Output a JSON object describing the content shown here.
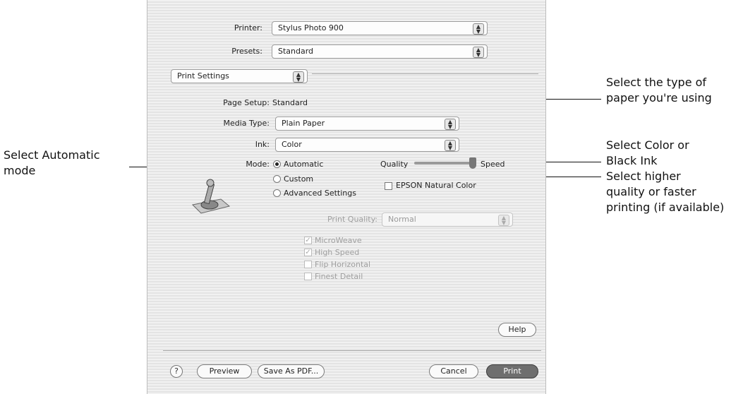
{
  "callouts": {
    "paper_type": "Select the type of\npaper you're using",
    "color_ink": "Select Color or\nBlack Ink",
    "automatic_mode": "Select Automatic\nmode",
    "quality_speed": "Select higher\nquality or faster\nprinting (if available)"
  },
  "dialog": {
    "printer_label": "Printer:",
    "printer_value": "Stylus Photo 900",
    "presets_label": "Presets:",
    "presets_value": "Standard",
    "panel_value": "Print Settings",
    "page_setup_label": "Page Setup:",
    "page_setup_value": "Standard",
    "media_type_label": "Media Type:",
    "media_type_value": "Plain Paper",
    "ink_label": "Ink:",
    "ink_value": "Color",
    "mode_label": "Mode:",
    "mode_automatic": "Automatic",
    "mode_custom": "Custom",
    "mode_advanced": "Advanced Settings",
    "quality_label": "Quality",
    "speed_label": "Speed",
    "natural_color_label": "EPSON Natural Color",
    "print_quality_label": "Print Quality:",
    "print_quality_value": "Normal",
    "microweave_label": "MicroWeave",
    "high_speed_label": "High Speed",
    "flip_horizontal_label": "Flip Horizontal",
    "finest_detail_label": "Finest Detail",
    "help_button": "Help",
    "help_icon": "?",
    "preview_button": "Preview",
    "save_pdf_button": "Save As PDF...",
    "cancel_button": "Cancel",
    "print_button": "Print"
  }
}
